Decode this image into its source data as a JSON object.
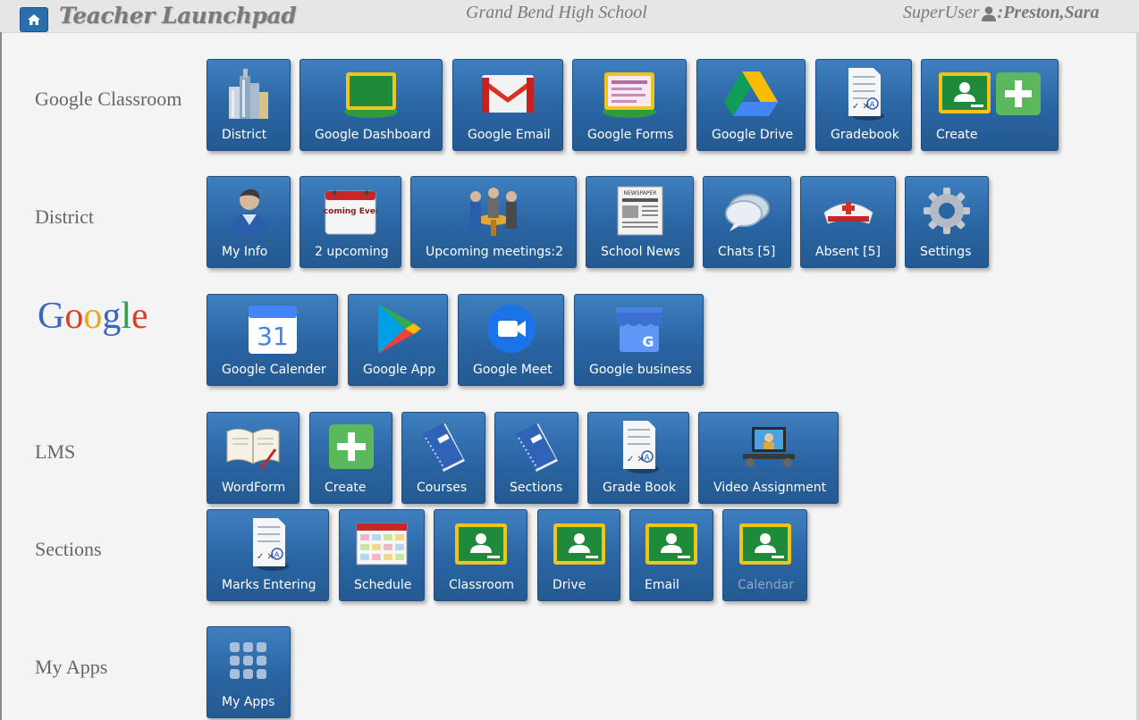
{
  "header": {
    "app_title": "Teacher Launchpad",
    "school_name": "Grand Bend High School",
    "role_label": "SuperUser",
    "user_name": ":Preston,Sara"
  },
  "rows": {
    "google_classroom": {
      "label": "Google Classroom",
      "tiles": [
        "District",
        "Google Dashboard",
        "Google Email",
        "Google Forms",
        "Google Drive",
        "Gradebook",
        "Create"
      ]
    },
    "district": {
      "label": "District",
      "tiles": [
        "My Info",
        "2 upcoming",
        "Upcoming meetings:2",
        "School News",
        "Chats [5]",
        "Absent [5]",
        "Settings"
      ]
    },
    "google": {
      "logo_text": "Google",
      "tiles": [
        "Google Calender",
        "Google App",
        "Google Meet",
        "Google business"
      ]
    },
    "lms": {
      "label": "LMS",
      "tiles": [
        "WordForm",
        "Create",
        "Courses",
        "Sections",
        "Grade Book",
        "Video Assignment"
      ]
    },
    "sections": {
      "label": "Sections",
      "tiles": [
        "Marks Entering",
        "Schedule",
        "Classroom",
        "Drive",
        "Email",
        "Calendar"
      ]
    },
    "my_apps": {
      "label": "My Apps",
      "tiles": [
        "My Apps"
      ]
    }
  },
  "icon_text": {
    "upcoming_events": "Upcoming Events",
    "calendar_day": "31",
    "newspaper": "NEWSPAPER"
  },
  "colors": {
    "tile_blue": "#2a64a2",
    "header_bg": "#e6e6e6",
    "label_gray": "#666666",
    "classroom_green": "#2e7d32",
    "dim_label": "#8ea9c6"
  }
}
